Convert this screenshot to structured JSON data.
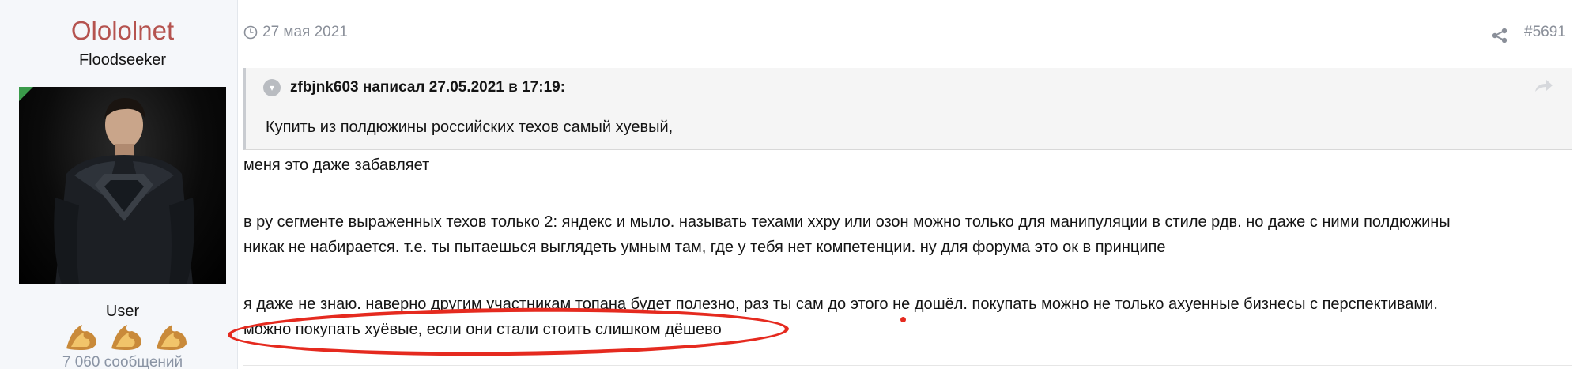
{
  "user": {
    "name": "Olololnet",
    "title": "Floodseeker",
    "role": "User",
    "messages": "7 060 сообщений",
    "avatar_icon": "avatar-image",
    "name_color": "#b5534f"
  },
  "header": {
    "date": "27 мая 2021",
    "post_number": "#5691"
  },
  "quote": {
    "attribution": "zfbjnk603 написал 27.05.2021 в 17:19:",
    "text": "Купить из полдюжины российских техов самый хуевый,"
  },
  "body": {
    "line1": "меня это даже забавляет",
    "line2": "в ру сегменте выраженных техов только 2: яндекс и мыло. называть техами ххру или озон можно только для манипуляции в стиле рдв. но даже с ними полдюжины",
    "line3": "никак не набирается. т.е. ты пытаешься выглядеть умным там, где у тебя нет компетенции. ну для форума это ок в принципе",
    "line4": "я даже не знаю. наверно другим участникам топана будет полезно, раз ты сам до этого не дошёл. покупать можно не только ахуенные бизнесы с перспективами.",
    "line5": "можно покупать хуёвые, если они стали стоить слишком дёшево"
  },
  "colors": {
    "annotation": "#e52a1f",
    "user_column_bg": "#f5f7fa"
  }
}
